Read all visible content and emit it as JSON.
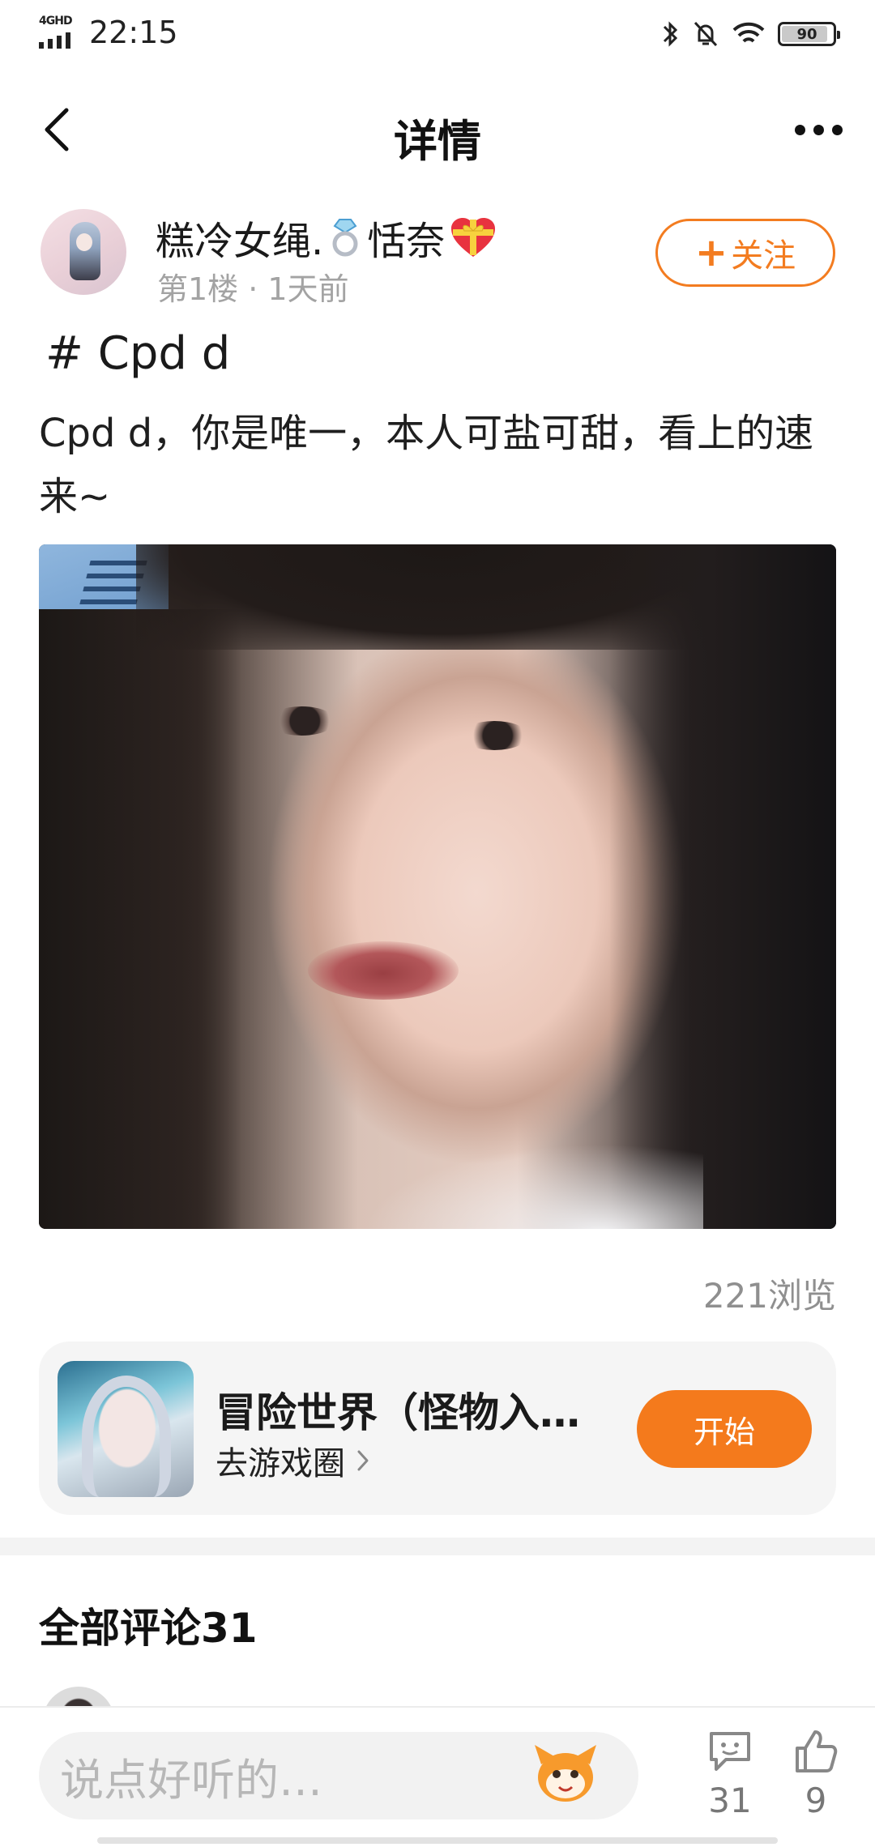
{
  "status_bar": {
    "network": "4GHD",
    "time": "22:15",
    "battery": "90",
    "battery_level": 0.9
  },
  "header": {
    "title": "详情"
  },
  "post": {
    "author_name": "糕冷女绳.",
    "author_name_suffix": "恬奈",
    "meta": "第1楼 · 1天前",
    "follow_label": "关注",
    "tag": "# Cpd d",
    "body": "Cpd d，你是唯一，本人可盐可甜，看上的速来~",
    "views": "221浏览"
  },
  "game_card": {
    "title": "冒险世界（怪物入…",
    "link_label": "去游戏圈",
    "start_label": "开始"
  },
  "comments": {
    "title": "全部评论31"
  },
  "bottom_bar": {
    "input_placeholder": "说点好听的…",
    "reply_count": "31",
    "like_count": "9"
  },
  "colors": {
    "accent": "#f37c20",
    "text": "#1f1f1f",
    "muted": "#a3a3a3"
  }
}
